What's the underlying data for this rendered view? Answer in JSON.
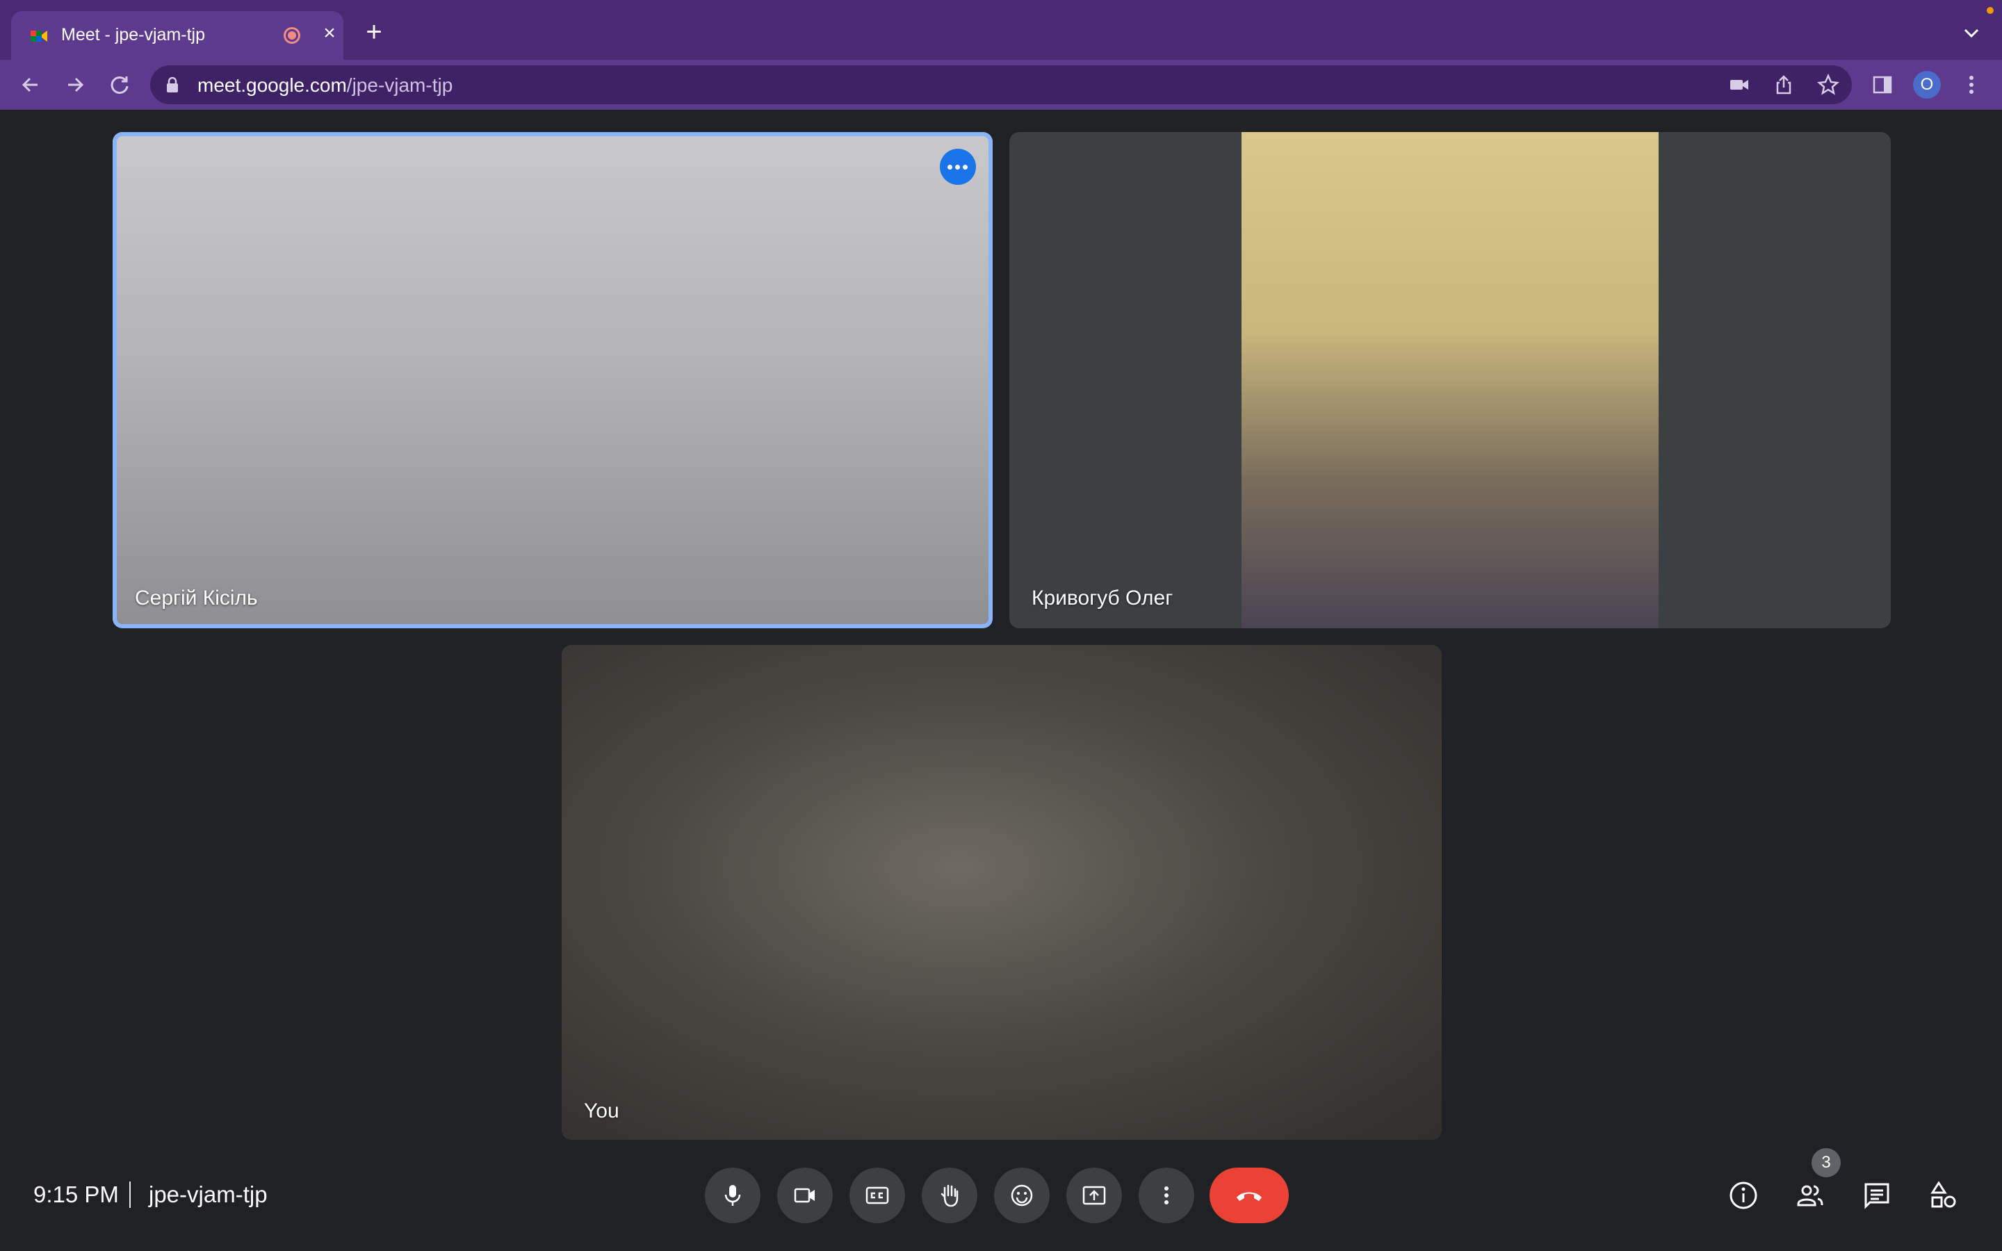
{
  "browser": {
    "tab_title": "Meet - jpe-vjam-tjp",
    "close_symbol": "×",
    "new_tab_symbol": "+",
    "url_host": "meet.google.com",
    "url_path": "/jpe-vjam-tjp",
    "profile_initial": "O",
    "colors": {
      "tabstrip": "#4a2a72",
      "toolbar": "#5e3a8e",
      "omnibox": "#3f2266"
    },
    "toolbar_icons": [
      "back-icon",
      "forward-icon",
      "reload-icon",
      "lock-icon",
      "camera-blocked-icon",
      "share-icon",
      "bookmark-star-icon",
      "side-panel-icon",
      "kebab-menu-icon"
    ]
  },
  "meet": {
    "participants": [
      {
        "name": "Сергій Кісіль",
        "active_speaker": true
      },
      {
        "name": "Кривогуб Олег",
        "active_speaker": false
      },
      {
        "name": "You",
        "active_speaker": false
      }
    ],
    "time": "9:15 PM",
    "separator": "|",
    "meeting_code": "jpe-vjam-tjp",
    "participant_count": "3",
    "controls": [
      "mic-icon",
      "camera-icon",
      "captions-icon",
      "raise-hand-icon",
      "emoji-icon",
      "present-screen-icon",
      "more-options-icon",
      "hang-up-icon"
    ],
    "side_controls": [
      "info-icon",
      "people-icon",
      "chat-icon",
      "activities-icon"
    ],
    "colors": {
      "background": "#202124",
      "control": "#3c4043",
      "hangup": "#ea4335",
      "speaker_border": "#8ab4f8"
    }
  }
}
